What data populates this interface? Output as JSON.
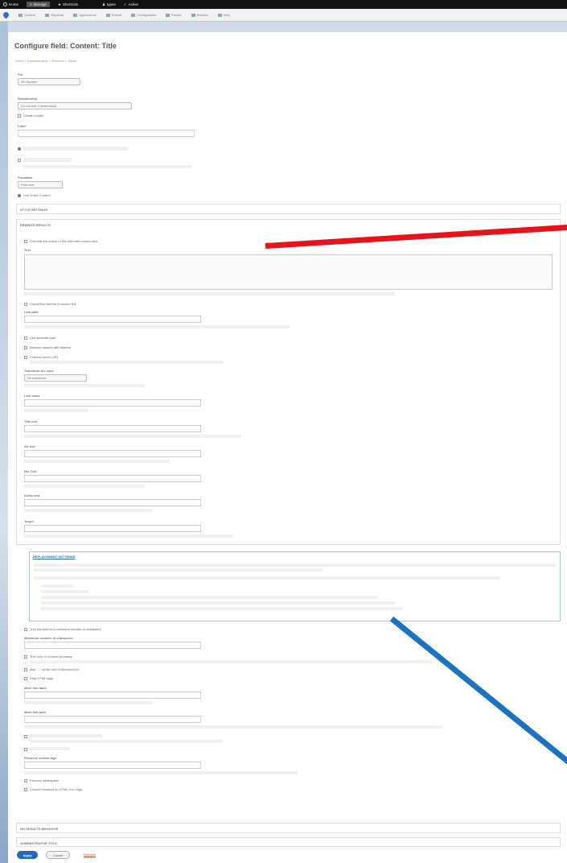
{
  "toolbar": {
    "items": [
      {
        "icon": "drupal-icon",
        "label": "Home"
      },
      {
        "icon": "menu-icon",
        "label": "Manage"
      },
      {
        "icon": "star-icon",
        "label": "Shortcuts"
      },
      {
        "icon": "user-icon",
        "label": "types"
      }
    ],
    "status": "Active"
  },
  "admin_menu": {
    "items": [
      "Content",
      "Structure",
      "Appearance",
      "Extend",
      "Configuration",
      "People",
      "Reports",
      "Help"
    ]
  },
  "page": {
    "title": "Configure field: Content: Title",
    "breadcrumb": "Home » Administration » Structure » Views"
  },
  "form": {
    "for_label": "For",
    "for_value": "All displays",
    "relationship_label": "Relationship",
    "relationship_value": "Do not use a relationship",
    "create_label_text": "Create a label",
    "label_label": "Label",
    "formatter_label": "Formatter",
    "formatter_value": "Plain text",
    "link_to_content_text": "Link to the Content",
    "style_settings": "STYLE SETTINGS",
    "rewrite_results": "REWRITE RESULTS",
    "override_text": "Override the output of this field with custom text",
    "text_label": "Text",
    "output_link_text": "Output this field as a custom link",
    "link_path_label": "Link path",
    "use_absolute_text": "Use absolute path",
    "replace_spaces_text": "Replace spaces with dashes",
    "external_text": "External server URL",
    "transform_case_label": "Transform the case",
    "transform_case_value": "No transform",
    "link_class_label": "Link class",
    "title_text_label": "Title text",
    "alt_text_label": "Alt text",
    "rel_text_label": "Rel Text",
    "prefix_label": "Prefix text",
    "suffix_label": "Suffix text",
    "target_label": "Target",
    "replacement_patterns": "REPLACEMENT PATTERNS",
    "trim_text": "Trim this field to a maximum number of characters",
    "max_chars_label": "Maximum number of characters",
    "trim_word_text": "Trim only on a word boundary",
    "ellipsis_text": "Add \"...\" at the end of trimmed text",
    "strip_tags_text": "Strip HTML tags",
    "more_link_label": "More link label",
    "more_link_path_label": "More link path",
    "preserve_tags_label": "Preserve certain tags",
    "remove_whitespace_text": "Remove whitespace",
    "convert_newlines_text": "Convert newlines to HTML <br> tags",
    "no_results": "NO RESULTS BEHAVIOR",
    "admin_title": "ADMINISTRATIVE TITLE"
  },
  "buttons": {
    "apply": "Apply",
    "cancel": "Cancel",
    "remove": "Remove"
  },
  "annotation_colors": {
    "red_arrow": "#e5141b",
    "blue_arrow": "#1a73c0"
  }
}
